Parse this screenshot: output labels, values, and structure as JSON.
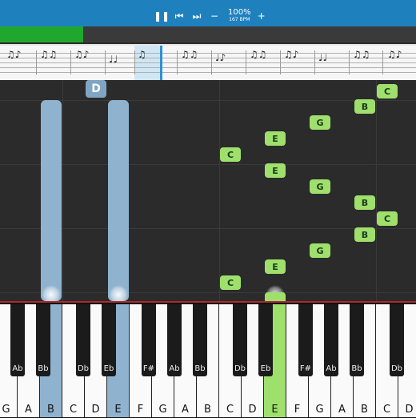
{
  "controls": {
    "zoom": "100%",
    "bpm": "167 BPM",
    "pause_icon": "pause-icon",
    "prev_icon": "skip-previous-icon",
    "next_icon": "skip-next-icon",
    "minus_icon": "minus-icon",
    "plus_icon": "plus-icon"
  },
  "progress": {
    "fraction": 0.2
  },
  "roll": {
    "top_label": "D",
    "green_notes": [
      "C",
      "B",
      "G",
      "E",
      "C",
      "E",
      "G",
      "B",
      "C",
      "B",
      "G",
      "E",
      "C",
      "E"
    ]
  },
  "keyboard": {
    "white_keys": [
      "G",
      "A",
      "B",
      "C",
      "D",
      "E",
      "F",
      "G",
      "A",
      "B",
      "C",
      "D",
      "E",
      "F",
      "G",
      "A",
      "B",
      "C",
      "D"
    ],
    "black_keys": [
      "Ab",
      "Bb",
      "Db",
      "Eb",
      "F#",
      "Ab",
      "Bb",
      "Db",
      "Eb",
      "F#",
      "Ab",
      "Bb",
      "Db"
    ],
    "active_blue_white": [
      "B",
      "E"
    ],
    "active_green_white": [
      "E"
    ]
  },
  "colors": {
    "accent": "#1f80be",
    "progress": "#1fa82d",
    "green_note": "#9fe06c",
    "blue_note": "#8fb3cf",
    "red_line": "#b02a2a"
  }
}
